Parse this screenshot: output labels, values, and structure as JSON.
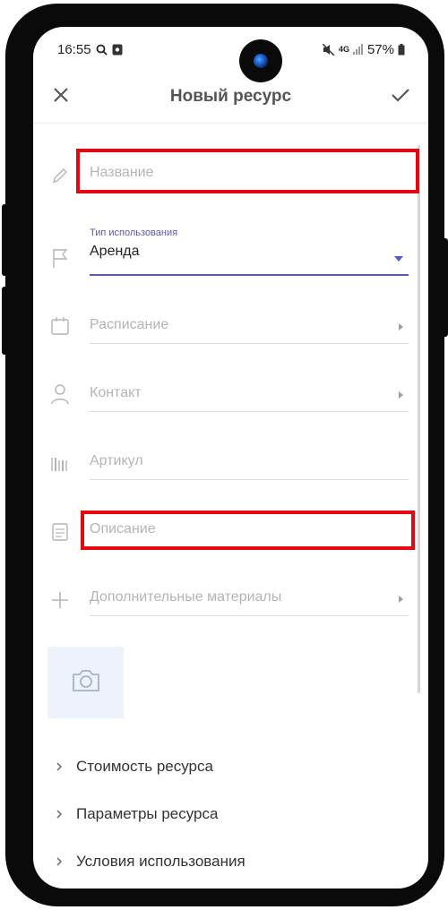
{
  "status_bar": {
    "time": "16:55",
    "network": "4G",
    "battery": "57%"
  },
  "app_bar": {
    "title": "Новый ресурс",
    "close_icon": "close-icon",
    "confirm_icon": "check-icon"
  },
  "form": {
    "name": {
      "placeholder": "Название",
      "icon": "pencil-icon"
    },
    "usage_type": {
      "label": "Тип использования",
      "value": "Аренда",
      "icon": "flag-icon"
    },
    "schedule": {
      "placeholder": "Расписание",
      "icon": "calendar-icon"
    },
    "contact": {
      "placeholder": "Контакт",
      "icon": "person-icon"
    },
    "article": {
      "placeholder": "Артикул",
      "icon": "barcode-icon"
    },
    "description": {
      "placeholder": "Описание",
      "icon": "notes-icon"
    },
    "extra_materials": {
      "placeholder": "Дополнительные материалы",
      "icon": "plus-icon"
    },
    "photo": {
      "icon": "camera-icon"
    }
  },
  "sections": [
    {
      "label": "Стоимость ресурса"
    },
    {
      "label": "Параметры ресурса"
    },
    {
      "label": "Условия использования"
    }
  ],
  "colors": {
    "highlight": "#e30613",
    "accent": "#4a5ac8",
    "photo_bg": "#eef3fb"
  }
}
